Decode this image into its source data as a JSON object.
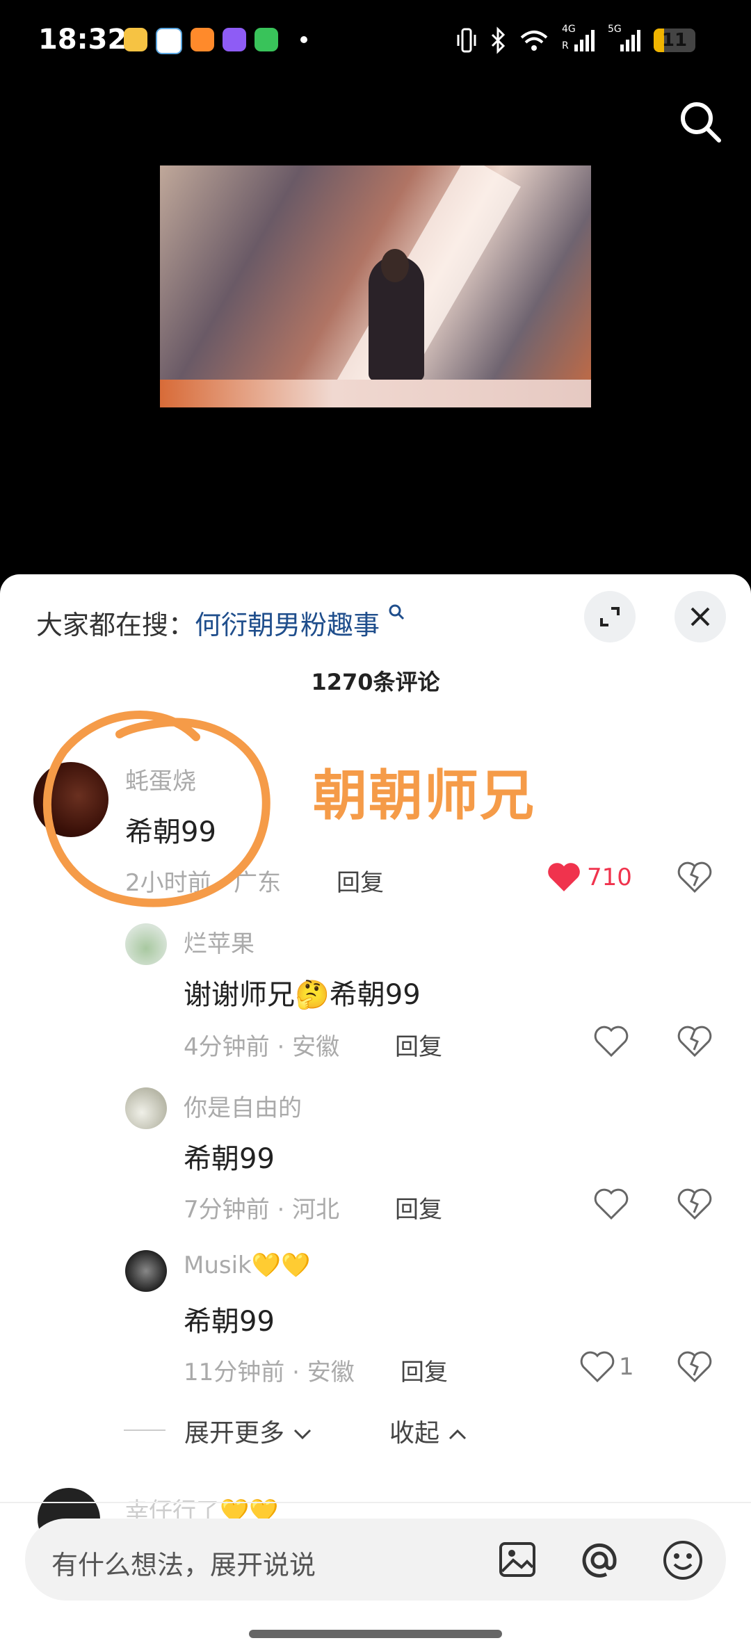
{
  "status_bar": {
    "time": "18:32",
    "battery_level": "11",
    "battery_fraction": 0.11,
    "app_icons": [
      "weibo-icon",
      "gallery-icon",
      "note-app-icon",
      "purple-app-icon",
      "green-app-icon"
    ],
    "signal_labels": {
      "a": "4G",
      "b": "R",
      "c": "5G"
    }
  },
  "hot_search": {
    "prefix": "大家都在搜：",
    "keyword": "何衍朝男粉趣事"
  },
  "comment_count": "1270条评论",
  "annotation": {
    "text": "朝朝师兄",
    "color": "#f59b48"
  },
  "comments": [
    {
      "user": "蚝蛋烧",
      "text": "希朝99",
      "time": "2小时前",
      "location": "广东",
      "reply": "回复",
      "likes": "710",
      "liked": true
    }
  ],
  "replies": [
    {
      "user": "烂苹果",
      "text": "谢谢师兄🤔希朝99",
      "time": "4分钟前",
      "location": "安徽",
      "reply": "回复",
      "likes": ""
    },
    {
      "user": "你是自由的",
      "text": "希朝99",
      "time": "7分钟前",
      "location": "河北",
      "reply": "回复",
      "likes": ""
    },
    {
      "user": "Musik💛💛",
      "text": "希朝99",
      "time": "11分钟前",
      "location": "安徽",
      "reply": "回复",
      "likes": "1"
    }
  ],
  "expand_more": "展开更多",
  "collapse": "收起",
  "next_comment_user_partial": "幸仔行了💛💛",
  "input": {
    "placeholder": "有什么想法，展开说说"
  },
  "colors": {
    "like_red": "#f0334d",
    "keyword_blue": "#1f4e8c"
  }
}
